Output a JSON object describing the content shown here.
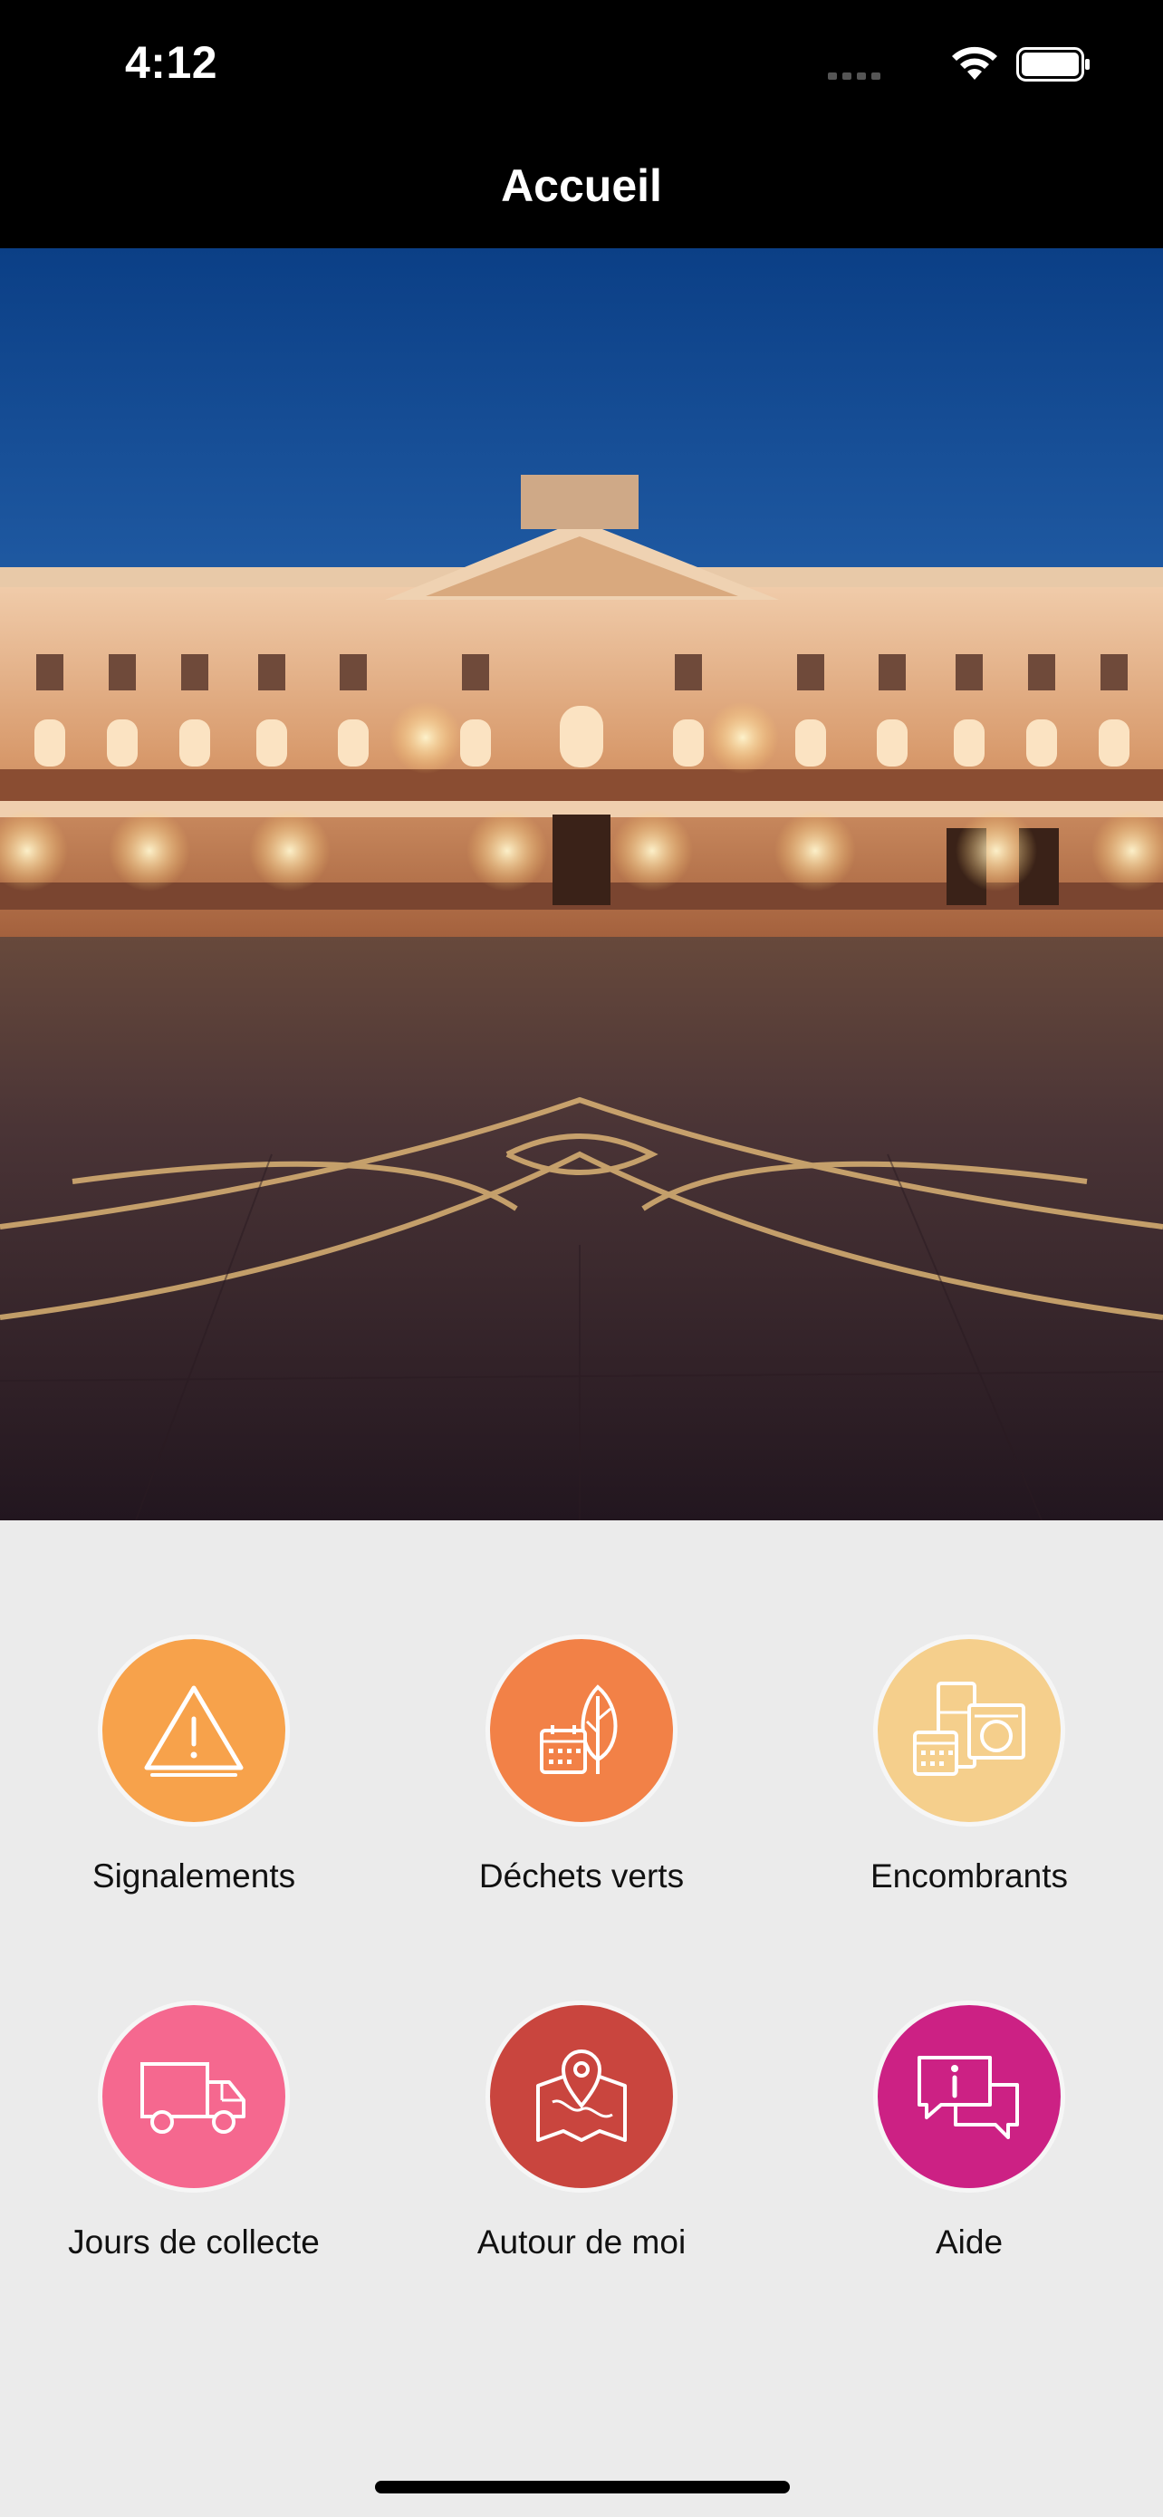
{
  "status_bar": {
    "time": "4:12",
    "icons": [
      "cellular-signal-icon",
      "wifi-icon",
      "battery-icon"
    ]
  },
  "nav": {
    "title": "Accueil"
  },
  "hero_image": {
    "description_icon": "capitole-night-photo"
  },
  "tiles": [
    {
      "label": "Signalements",
      "icon": "warning-triangle-icon",
      "color": "#f7a24b"
    },
    {
      "label": "Déchets verts",
      "icon": "leaf-calendar-icon",
      "color": "#f28147"
    },
    {
      "label": "Encombrants",
      "icon": "appliances-calendar-icon",
      "color": "#f5cf8c"
    },
    {
      "label": "Jours de collecte",
      "icon": "truck-icon",
      "color": "#f5688f"
    },
    {
      "label": "Autour de moi",
      "icon": "map-pin-icon",
      "color": "#c9453e"
    },
    {
      "label": "Aide",
      "icon": "chat-info-icon",
      "color": "#cc2184"
    }
  ]
}
